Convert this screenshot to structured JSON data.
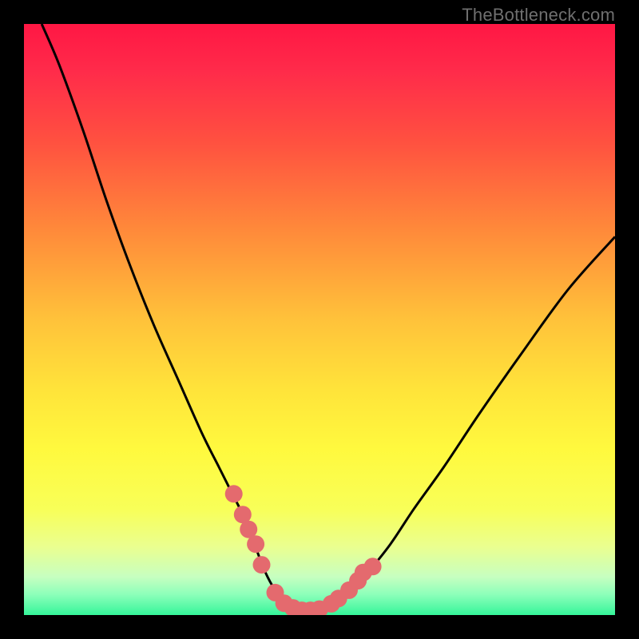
{
  "watermark": "TheBottleneck.com",
  "gradient_stops": [
    {
      "offset": 0.0,
      "color": "#ff1744"
    },
    {
      "offset": 0.08,
      "color": "#ff2b4a"
    },
    {
      "offset": 0.2,
      "color": "#ff5140"
    },
    {
      "offset": 0.35,
      "color": "#ff8a3a"
    },
    {
      "offset": 0.5,
      "color": "#ffc23a"
    },
    {
      "offset": 0.62,
      "color": "#ffe43a"
    },
    {
      "offset": 0.72,
      "color": "#fff93e"
    },
    {
      "offset": 0.82,
      "color": "#f8ff58"
    },
    {
      "offset": 0.885,
      "color": "#eaff90"
    },
    {
      "offset": 0.935,
      "color": "#c7ffc0"
    },
    {
      "offset": 0.965,
      "color": "#8dffba"
    },
    {
      "offset": 1.0,
      "color": "#35f59a"
    }
  ],
  "curve_color": "#000000",
  "curve_width": 3,
  "marker_color": "#e46a6e",
  "marker_radius": 11,
  "chart_data": {
    "type": "line",
    "title": "",
    "xlabel": "",
    "ylabel": "",
    "xlim": [
      0,
      100
    ],
    "ylim": [
      0,
      100
    ],
    "series": [
      {
        "name": "bottleneck-curve",
        "x": [
          3,
          6,
          10,
          14,
          18,
          22,
          26,
          30,
          33,
          35,
          37,
          39,
          40.5,
          42,
          43.5,
          45,
          47,
          49,
          52,
          55,
          58,
          62,
          66,
          71,
          77,
          84,
          92,
          100
        ],
        "y": [
          100,
          93,
          82,
          70,
          59,
          49,
          40,
          31,
          25,
          21,
          17,
          12,
          8,
          5,
          3,
          1.5,
          0.7,
          0.7,
          1.7,
          3.8,
          7,
          12,
          18,
          25,
          34,
          44,
          55,
          64
        ]
      }
    ],
    "markers": {
      "name": "highlight-points",
      "x": [
        35.5,
        37.0,
        38.0,
        39.2,
        40.2,
        42.5,
        44.0,
        45.5,
        47.0,
        48.5,
        50.0,
        52.0,
        53.2,
        55.0,
        56.5,
        57.4,
        59.0
      ],
      "y": [
        20.5,
        17.0,
        14.5,
        12.0,
        8.5,
        3.8,
        2.0,
        1.2,
        0.8,
        0.8,
        1.0,
        1.9,
        2.8,
        4.2,
        5.8,
        7.2,
        8.2
      ]
    }
  }
}
